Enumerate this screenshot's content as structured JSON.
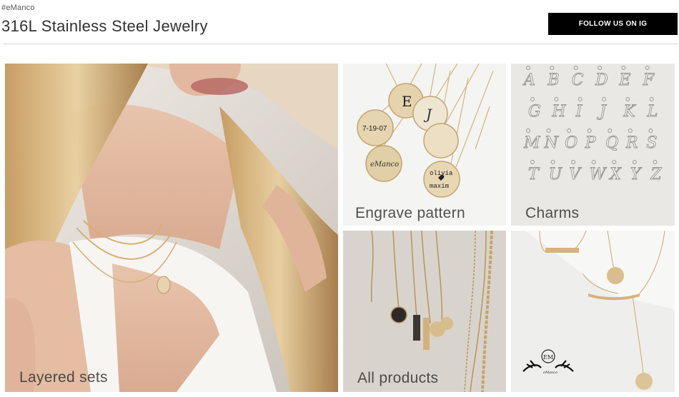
{
  "header": {
    "brand_tag": "#eManco",
    "title": "316L Stainless Steel Jewelry",
    "follow_button": "FOLLOW US ON IG"
  },
  "tiles": [
    {
      "label": "Layered sets"
    },
    {
      "label": "Engrave pattern"
    },
    {
      "label": "Charms"
    },
    {
      "label": "All products"
    },
    {
      "label": ""
    }
  ],
  "engrave_texts": [
    "E",
    "J",
    "7-19-07",
    "eManco",
    "olivia",
    "maxim"
  ],
  "charm_letters": [
    "A",
    "B",
    "C",
    "D",
    "E",
    "F",
    "G",
    "H",
    "I",
    "J",
    "K",
    "L",
    "M",
    "N",
    "O",
    "P",
    "Q",
    "R",
    "S",
    "T",
    "U",
    "V",
    "W",
    "X",
    "Y",
    "Z"
  ],
  "logo": {
    "monogram": "EM",
    "script": "eManco"
  }
}
